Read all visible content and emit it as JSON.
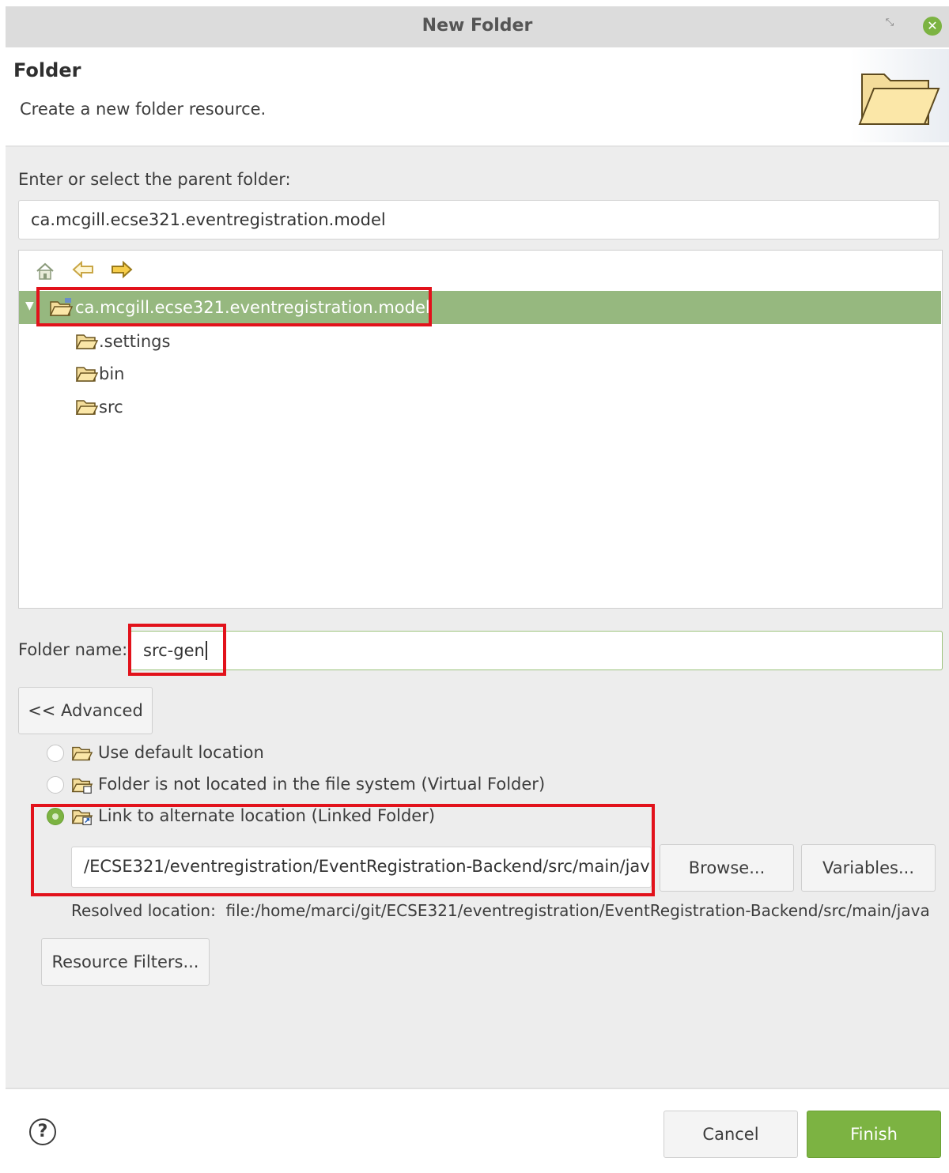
{
  "window": {
    "title": "New Folder"
  },
  "header": {
    "title": "Folder",
    "description": "Create a new folder resource."
  },
  "parent": {
    "label": "Enter or select the parent folder:",
    "value": "ca.mcgill.ecse321.eventregistration.model"
  },
  "tree": {
    "root": "ca.mcgill.ecse321.eventregistration.model",
    "children": [
      ".settings",
      "bin",
      "src"
    ]
  },
  "folder_name": {
    "label": "Folder name:",
    "value": "src-gen"
  },
  "advanced_button": "<< Advanced",
  "options": {
    "default_location": "Use default location",
    "virtual_folder": "Folder is not located in the file system (Virtual Folder)",
    "linked_folder": "Link to alternate location (Linked Folder)",
    "selected": "linked_folder"
  },
  "link_location": {
    "value": "/ECSE321/eventregistration/EventRegistration-Backend/src/main/java",
    "browse": "Browse...",
    "variables": "Variables..."
  },
  "resolved": {
    "label": "Resolved location:",
    "value": "file:/home/marci/git/ECSE321/eventregistration/EventRegistration-Backend/src/main/java"
  },
  "resource_filters": "Resource Filters...",
  "footer": {
    "help": "?",
    "cancel": "Cancel",
    "finish": "Finish"
  },
  "colors": {
    "accent": "#7cb342",
    "selection": "#96b87f",
    "highlight_box": "#e2121b"
  }
}
